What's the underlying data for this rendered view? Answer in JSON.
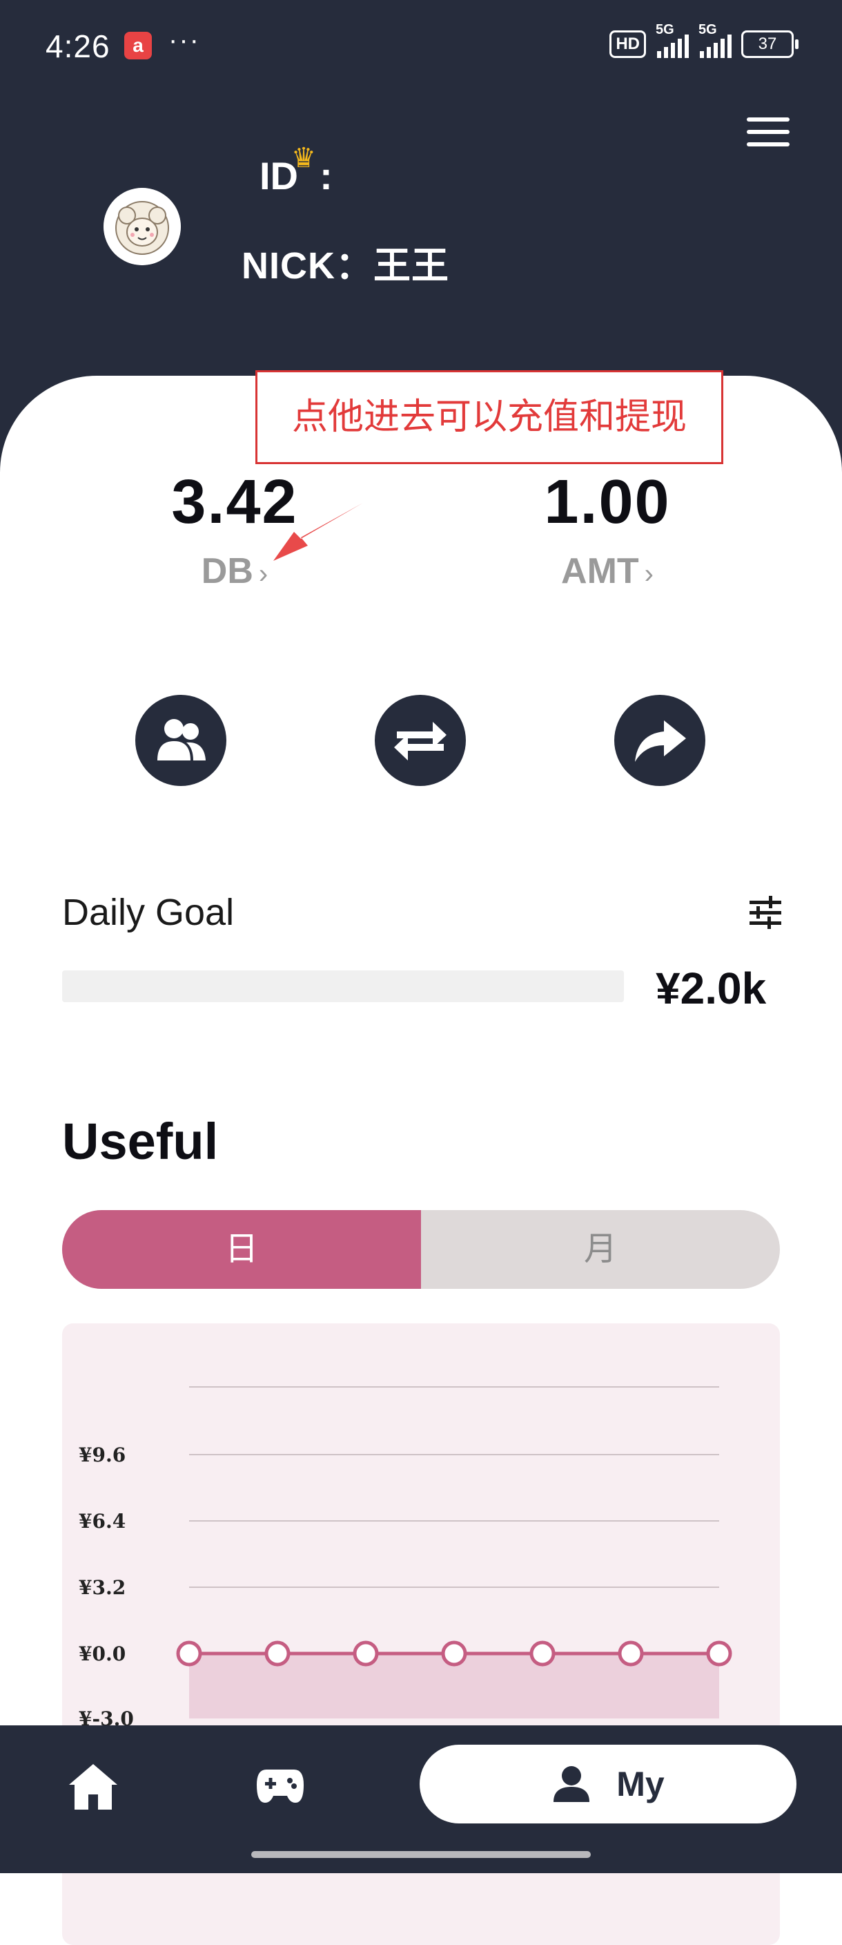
{
  "status_bar": {
    "time": "4:26",
    "app_badge": "a",
    "dots": "···",
    "hd": "HD",
    "net1": "5G",
    "net2": "5G",
    "battery": "37"
  },
  "profile": {
    "id_label": "ID",
    "id_sep": ":",
    "nick": "NICK：王王"
  },
  "annotation": {
    "text": "点他进去可以充值和提现"
  },
  "balances": [
    {
      "value": "3.42",
      "label": "DB",
      "chevron": "›"
    },
    {
      "value": "1.00",
      "label": "AMT",
      "chevron": "›"
    }
  ],
  "quick_actions": [
    "team-icon",
    "exchange-icon",
    "share-icon"
  ],
  "daily_goal": {
    "title": "Daily Goal",
    "amount": "¥2.0k",
    "progress": 0
  },
  "useful": {
    "title": "Useful",
    "tabs": [
      "日",
      "月"
    ],
    "active_tab": 0
  },
  "chart_data": {
    "type": "line",
    "ylabels": [
      "¥9.6",
      "¥6.4",
      "¥3.2",
      "¥0.0",
      "¥-3.0"
    ],
    "yticks": [
      9.6,
      6.4,
      3.2,
      0.0,
      -3.0
    ],
    "x": [
      1,
      2,
      3,
      4,
      5,
      6,
      7
    ],
    "values": [
      0,
      0,
      0,
      0,
      0,
      0,
      0
    ],
    "grid": true,
    "line_color": "#c55d82",
    "fill_color": "#ecd0dc"
  },
  "bottom_nav": {
    "home_icon": "home-icon",
    "game_icon": "gamepad-icon",
    "my_label": "My"
  },
  "colors": {
    "dark": "#262c3c",
    "accent": "#c55d82",
    "annotation": "#e23a3a"
  }
}
